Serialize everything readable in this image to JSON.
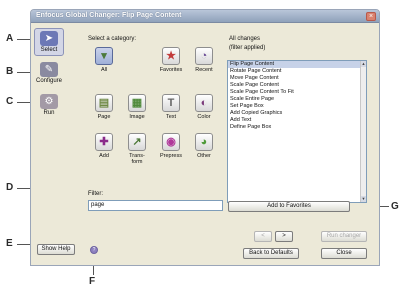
{
  "window": {
    "title": "Enfocus Global Changer: Flip Page Content",
    "close_glyph": "×"
  },
  "callouts": [
    "A",
    "B",
    "C",
    "D",
    "E",
    "F",
    "G"
  ],
  "modes": [
    {
      "label": "Select",
      "icon": "select-arrow-icon",
      "selected": true,
      "color": "#6c78b6"
    },
    {
      "label": "Configure",
      "icon": "wrench-icon",
      "selected": false,
      "color": "#8a8aa0"
    },
    {
      "label": "Run",
      "icon": "run-icon",
      "selected": false,
      "color": "#a39aa6"
    }
  ],
  "category_label": "Select a category:",
  "categories": [
    {
      "label": "All",
      "icon": "all-icon",
      "glyph": "▾",
      "color": "#4c7a3c",
      "selected": true
    },
    {
      "label": "Favorites",
      "icon": "favorites-icon",
      "glyph": "★",
      "color": "#c23a3a",
      "selected": false
    },
    {
      "label": "Recent",
      "icon": "clock-icon",
      "glyph": "◔",
      "color": "#6a4c96",
      "selected": false
    },
    {
      "label": "Page",
      "icon": "page-icon",
      "glyph": "▤",
      "color": "#6f8a45",
      "selected": false
    },
    {
      "label": "Image",
      "icon": "image-icon",
      "glyph": "▦",
      "color": "#4f8a3a",
      "selected": false
    },
    {
      "label": "Text",
      "icon": "text-icon",
      "glyph": "T",
      "color": "#666666",
      "selected": false
    },
    {
      "label": "Color",
      "icon": "color-icon",
      "glyph": "◐",
      "color": "#7a3a7a",
      "selected": false
    },
    {
      "label": "Add",
      "icon": "add-icon",
      "glyph": "✚",
      "color": "#8a2a8a",
      "selected": false
    },
    {
      "label": "Trans-\nform",
      "icon": "transform-icon",
      "glyph": "↗",
      "color": "#4f7a3a",
      "selected": false
    },
    {
      "label": "Prepress",
      "icon": "prepress-icon",
      "glyph": "◉",
      "color": "#b0389a",
      "selected": false
    },
    {
      "label": "Other",
      "icon": "other-icon",
      "glyph": "◕",
      "color": "#4f9a3a",
      "selected": false
    }
  ],
  "changes": {
    "header": "All changes",
    "subheader": "(filter applied)",
    "items": [
      "Flip Page Content",
      "Rotate Page Content",
      "Move Page Content",
      "Scale Page Content",
      "Scale Page Content To Fit",
      "Scale Entire Page",
      "Set Page Box",
      "Add Copied Graphics",
      "Add Text",
      "Define Page Box"
    ],
    "selected_index": 0
  },
  "filter": {
    "label": "Filter:",
    "value": "page"
  },
  "buttons": {
    "add_to_favorites": "Add to Favorites",
    "back": "<",
    "next": ">",
    "run_changer": "Run changer",
    "back_to_defaults": "Back to Defaults",
    "close": "Close",
    "show_help": "Show Help"
  },
  "help_dot_glyph": "?"
}
